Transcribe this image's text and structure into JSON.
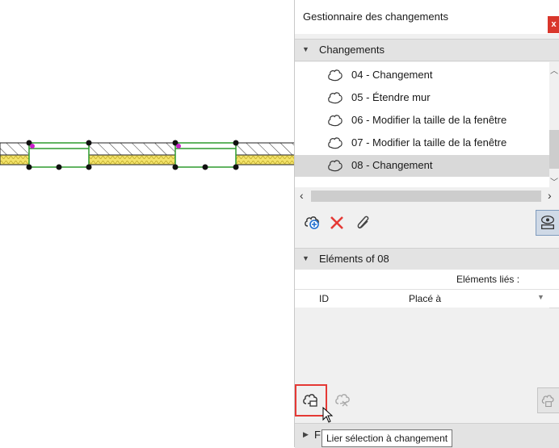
{
  "panel": {
    "title": "Gestionnaire des changements",
    "close_label": "x"
  },
  "changes_section": {
    "label": "Changements",
    "items": [
      {
        "label": "04 - Changement",
        "selected": false
      },
      {
        "label": "05 - Étendre mur",
        "selected": false
      },
      {
        "label": "06 - Modifier la taille de la fenêtre",
        "selected": false
      },
      {
        "label": "07 - Modifier la taille de la fenêtre",
        "selected": false
      },
      {
        "label": "08 - Changement",
        "selected": true
      }
    ],
    "toolbar": [
      "new-change-icon",
      "delete-icon",
      "link-icon",
      "show-hide-icon"
    ]
  },
  "elements_section": {
    "label": "Eléments of 08",
    "linked_label": "Eléments liés :",
    "columns": [
      "ID",
      "Placé à"
    ]
  },
  "bottom_section": {
    "label": "F"
  },
  "tooltip": {
    "text": "Lier sélection à changement"
  },
  "colors": {
    "accent_red": "#e53935",
    "close_red": "#d9362b",
    "wall_green": "#2e9b2e",
    "insulation_yellow": "#f3e36a",
    "selected_row": "#d9d9d9"
  }
}
